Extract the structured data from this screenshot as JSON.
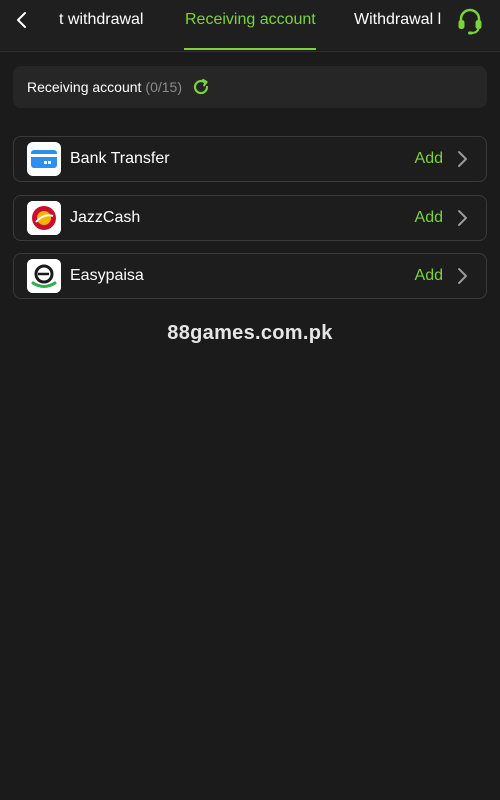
{
  "tabs": {
    "left": "t withdrawal",
    "active": "Receiving account",
    "right": "Withdrawal l"
  },
  "header": {
    "title": "Receiving account",
    "count": "(0/15)"
  },
  "methods": [
    {
      "label": "Bank Transfer",
      "action": "Add",
      "icon": "bank-card-icon"
    },
    {
      "label": "JazzCash",
      "action": "Add",
      "icon": "jazzcash-logo"
    },
    {
      "label": "Easypaisa",
      "action": "Add",
      "icon": "easypaisa-logo"
    }
  ],
  "watermark": "88games.com.pk",
  "colors": {
    "accent": "#7bd33b",
    "background": "#1b1b1b",
    "card": "#262626"
  }
}
